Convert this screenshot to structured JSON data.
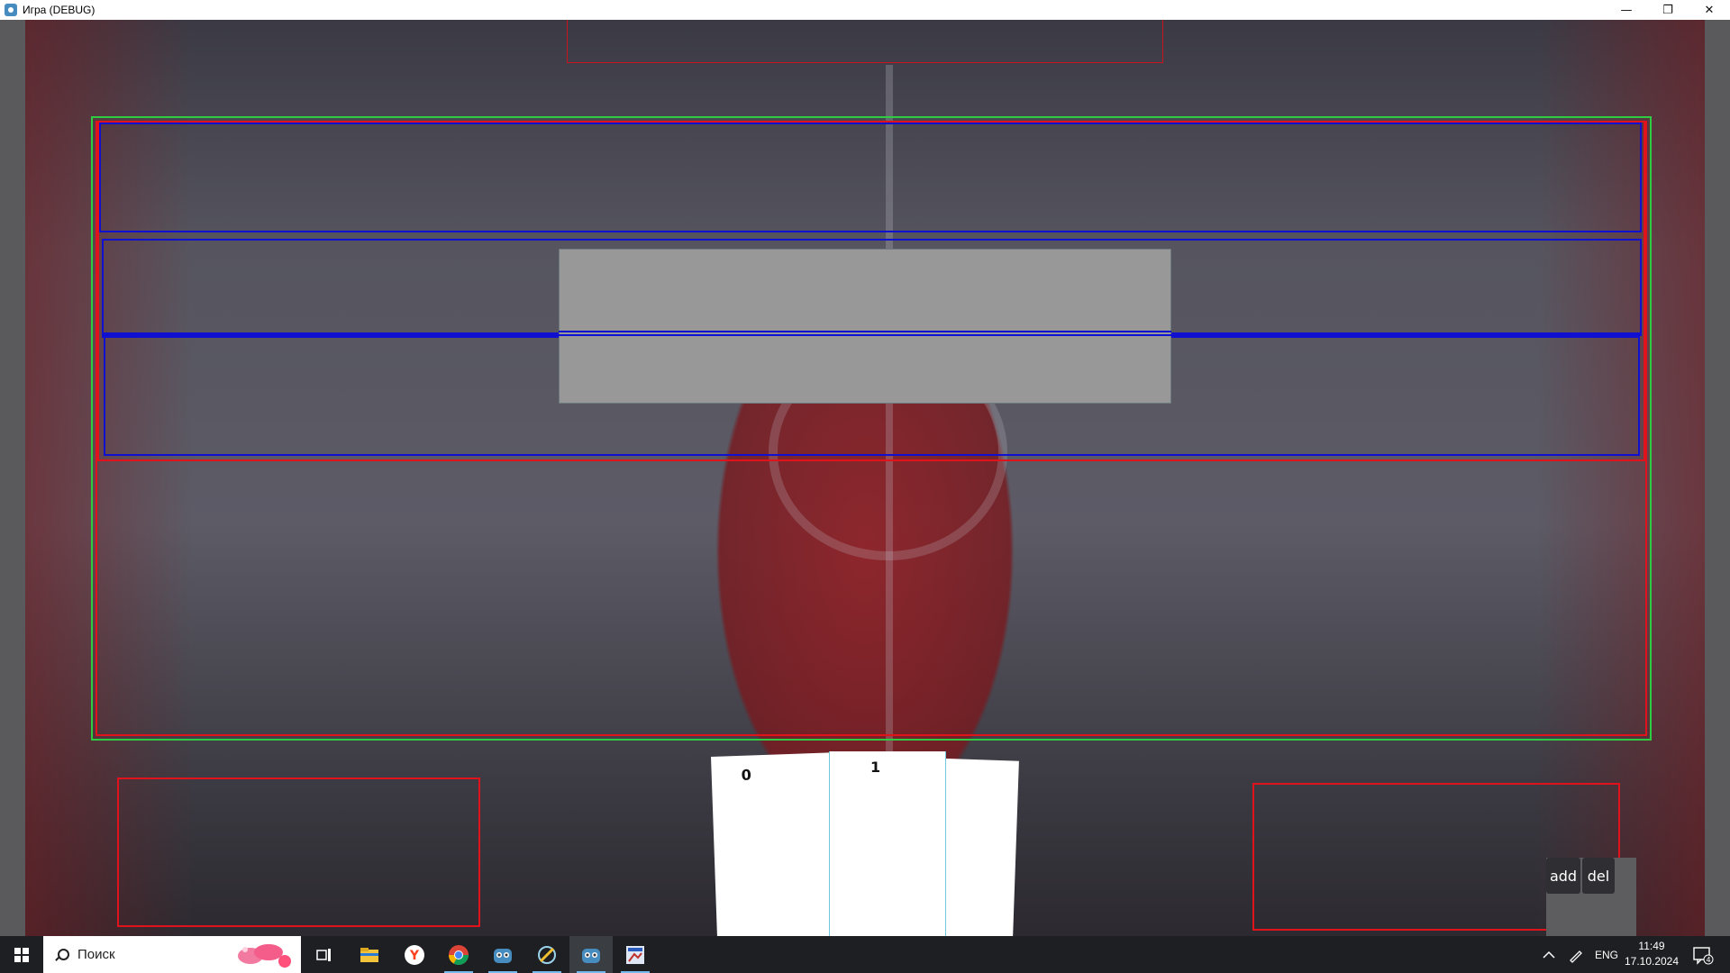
{
  "window": {
    "title": "Игра (DEBUG)",
    "controls": {
      "minimize_icon": "minimize-icon",
      "restore_icon": "restore-icon",
      "close_icon": "close-icon"
    }
  },
  "game": {
    "cards": [
      {
        "label": "0"
      },
      {
        "label": "1"
      },
      {
        "label": ""
      }
    ],
    "buttons": {
      "add": "add",
      "del": "del"
    },
    "colors": {
      "debug_red": "#e0121b",
      "debug_green": "#2ecc40",
      "debug_blue": "#1010d0",
      "panel_grey": "#989898"
    }
  },
  "taskbar": {
    "search_placeholder": "Поиск",
    "apps": [
      "task-view-icon",
      "file-explorer-icon",
      "yandex-browser-icon",
      "chrome-icon",
      "godot-icon",
      "godot-editor-icon",
      "godot-game-icon",
      "debug-window-icon"
    ],
    "tray": {
      "lang": "ENG",
      "time": "11:49",
      "date": "17.10.2024",
      "notifications": "4"
    }
  }
}
